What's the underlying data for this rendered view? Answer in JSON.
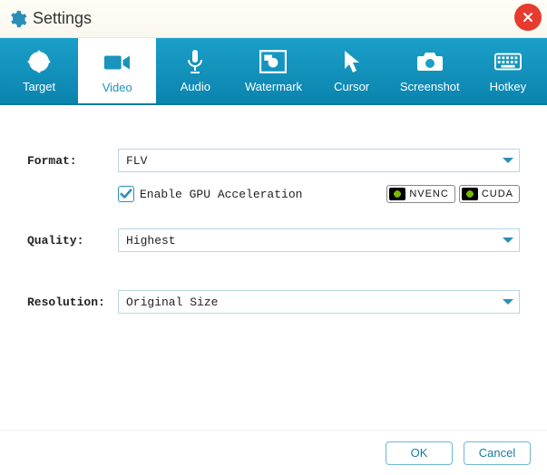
{
  "window": {
    "title": "Settings"
  },
  "tabs": [
    {
      "label": "Target"
    },
    {
      "label": "Video"
    },
    {
      "label": "Audio"
    },
    {
      "label": "Watermark"
    },
    {
      "label": "Cursor"
    },
    {
      "label": "Screenshot"
    },
    {
      "label": "Hotkey"
    }
  ],
  "active_tab_index": 1,
  "form": {
    "format": {
      "label": "Format:",
      "value": "FLV"
    },
    "gpu": {
      "checked": true,
      "label": "Enable GPU Acceleration"
    },
    "badges": {
      "nvenc": "NVENC",
      "cuda": "CUDA"
    },
    "quality": {
      "label": "Quality:",
      "value": "Highest"
    },
    "resolution": {
      "label": "Resolution:",
      "value": "Original Size"
    }
  },
  "footer": {
    "ok": "OK",
    "cancel": "Cancel"
  },
  "colors": {
    "accent": "#1a94bd",
    "tabstrip_top": "#1a9fc9",
    "tabstrip_bottom": "#0b84ae",
    "close": "#e63b2e"
  }
}
